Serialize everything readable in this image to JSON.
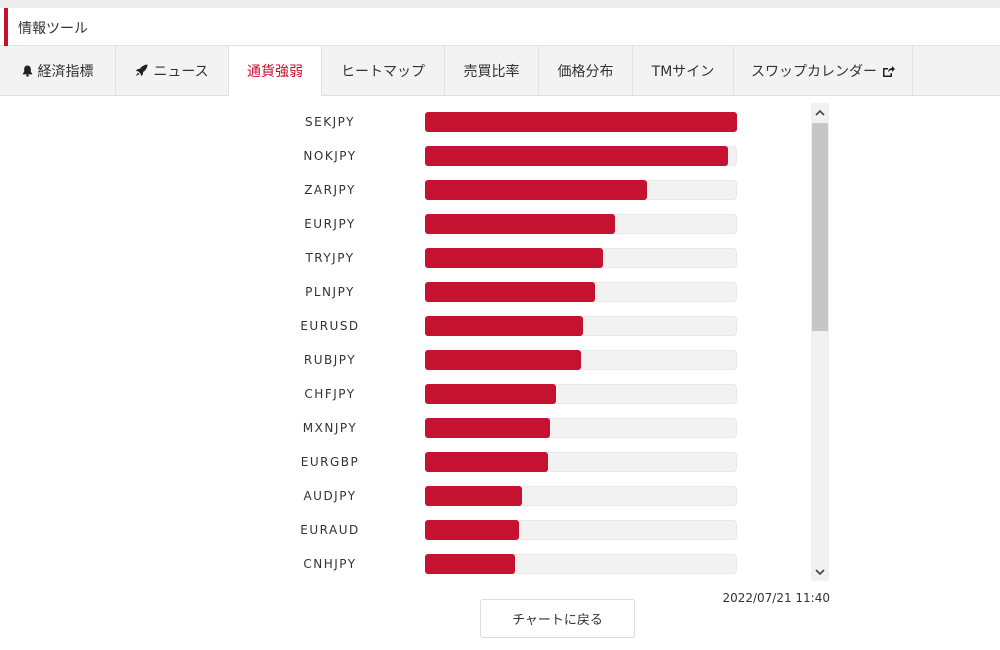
{
  "header": {
    "title": "情報ツール"
  },
  "tabs": [
    {
      "label": "経済指標",
      "icon": "bell-icon"
    },
    {
      "label": "ニュース",
      "icon": "rocket-icon"
    },
    {
      "label": "通貨強弱",
      "active": true
    },
    {
      "label": "ヒートマップ"
    },
    {
      "label": "売買比率"
    },
    {
      "label": "価格分布"
    },
    {
      "label": "TMサイン"
    },
    {
      "label": "スワップカレンダー",
      "icon_after": "external-link-icon"
    }
  ],
  "chart_data": {
    "type": "bar",
    "orientation": "horizontal",
    "categories": [
      "SEKJPY",
      "NOKJPY",
      "ZARJPY",
      "EURJPY",
      "TRYJPY",
      "PLNJPY",
      "EURUSD",
      "RUBJPY",
      "CHFJPY",
      "MXNJPY",
      "EURGBP",
      "AUDJPY",
      "EURAUD",
      "CNHJPY"
    ],
    "values": [
      100,
      97,
      71,
      61,
      57,
      54.5,
      50.5,
      50,
      42,
      40,
      39.5,
      31,
      30,
      29
    ],
    "xlim": [
      0,
      100
    ],
    "bar_color": "#c41230",
    "track_color": "#f2f2f2"
  },
  "footer": {
    "timestamp": "2022/07/21 11:40",
    "back_label": "チャートに戻る"
  },
  "colors": {
    "accent": "#c8102e"
  }
}
